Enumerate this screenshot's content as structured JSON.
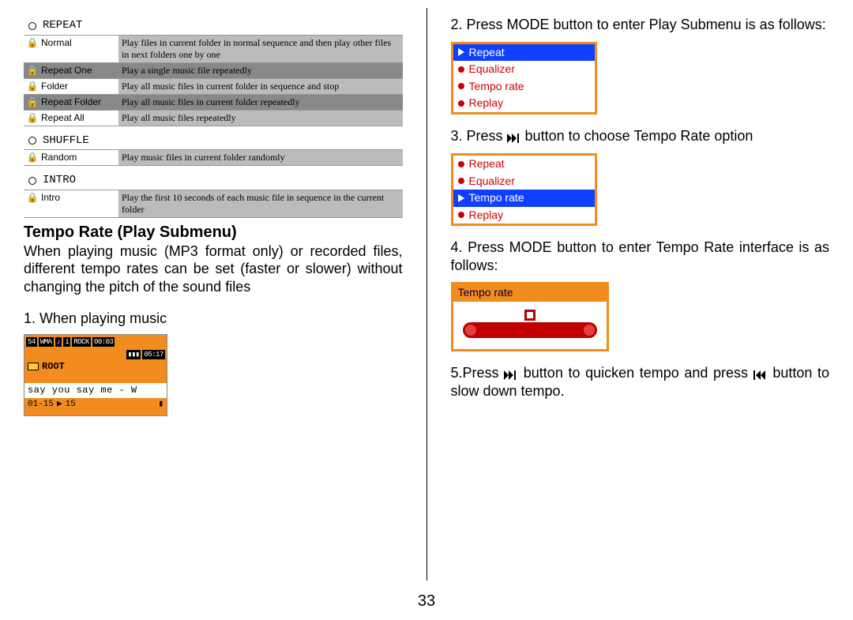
{
  "page_number": "33",
  "left": {
    "sections": [
      {
        "header": "REPEAT",
        "rows": [
          {
            "name": "Normal",
            "desc": "Play files in current folder in normal sequence and then play other files in next folders one by one"
          },
          {
            "name": "Repeat One",
            "desc": "Play a single music file repeatedly"
          },
          {
            "name": "Folder",
            "desc": "Play all music files in current folder in sequence and stop"
          },
          {
            "name": "Repeat Folder",
            "desc": "Play all music files in current folder repeatedly"
          },
          {
            "name": "Repeat All",
            "desc": "Play all music files repeatedly"
          }
        ]
      },
      {
        "header": "SHUFFLE",
        "rows": [
          {
            "name": "Random",
            "desc": "Play music files in current folder randomly"
          }
        ]
      },
      {
        "header": "INTRO",
        "rows": [
          {
            "name": "Intro",
            "desc": "Play the first 10 seconds of each music file in sequence in the current folder"
          }
        ]
      }
    ],
    "heading": "Tempo Rate (Play Submenu)",
    "body": "When playing music (MP3 format only) or recorded files, different tempo rates can be set (faster or slower) without changing the pitch of the sound files",
    "step1": "1. When playing music",
    "player": {
      "top_left": "54",
      "top_codec": "WMA",
      "top_bat": "i",
      "top_time1": "00:03",
      "top_time2": "05:17",
      "root_label": "ROOT",
      "track": "say you say me - W",
      "bot_left": "01-15",
      "bot_mid": "15"
    }
  },
  "right": {
    "step2": "2. Press MODE button to enter Play Submenu is as follows:",
    "menu1": [
      "Repeat",
      "Equalizer",
      "Tempo rate",
      "Replay"
    ],
    "menu1_selected": 0,
    "step3_a": "3. Press ",
    "step3_b": " button to choose Tempo Rate option",
    "menu2": [
      "Repeat",
      "Equalizer",
      "Tempo rate",
      "Replay"
    ],
    "menu2_selected": 2,
    "step4": "4. Press MODE button to enter Tempo Rate interface is as follows:",
    "tempo_header": "Tempo rate",
    "step5_a": "5.Press ",
    "step5_b": " button to quicken tempo and press ",
    "step5_c": " button to slow down tempo."
  }
}
